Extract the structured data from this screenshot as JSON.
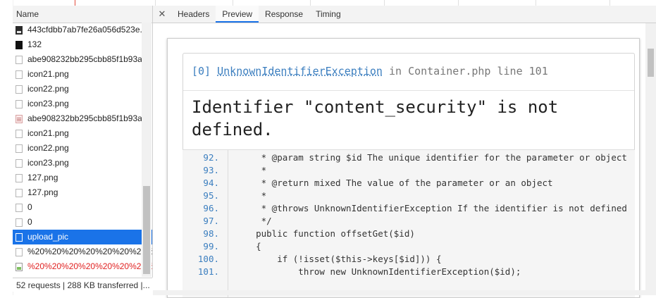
{
  "network": {
    "name_header": "Name",
    "rows": [
      {
        "label": "443cfdbb7ab7fe26a056d523e...",
        "icon": "image-thumbnail-icon",
        "state": "normal"
      },
      {
        "label": "132",
        "icon": "black-square-icon",
        "state": "normal"
      },
      {
        "label": "abe908232bb295cbb85f1b93a",
        "icon": "file-icon",
        "state": "normal"
      },
      {
        "label": "icon21.png",
        "icon": "file-icon",
        "state": "normal"
      },
      {
        "label": "icon22.png",
        "icon": "file-icon",
        "state": "normal"
      },
      {
        "label": "icon23.png",
        "icon": "file-icon",
        "state": "normal"
      },
      {
        "label": "abe908232bb295cbb85f1b93a",
        "icon": "document-icon",
        "state": "normal"
      },
      {
        "label": "icon21.png",
        "icon": "file-icon",
        "state": "normal"
      },
      {
        "label": "icon22.png",
        "icon": "file-icon",
        "state": "normal"
      },
      {
        "label": "icon23.png",
        "icon": "file-icon",
        "state": "normal"
      },
      {
        "label": "127.png",
        "icon": "file-icon",
        "state": "normal"
      },
      {
        "label": "127.png",
        "icon": "file-icon",
        "state": "normal"
      },
      {
        "label": "0",
        "icon": "file-icon",
        "state": "normal"
      },
      {
        "label": "0",
        "icon": "file-icon",
        "state": "normal"
      },
      {
        "label": "upload_pic",
        "icon": "file-icon",
        "state": "selected"
      },
      {
        "label": "%20%20%20%20%20%20%20%2",
        "icon": "file-icon",
        "state": "normal"
      },
      {
        "label": "%20%20%20%20%20%20%20%2",
        "icon": "broken-image-icon",
        "state": "error"
      }
    ],
    "status": "52 requests  |  288 KB transferred  |..."
  },
  "detail": {
    "close_glyph": "✕",
    "tabs": [
      {
        "label": "Headers",
        "active": false
      },
      {
        "label": "Preview",
        "active": true
      },
      {
        "label": "Response",
        "active": false
      },
      {
        "label": "Timing",
        "active": false
      }
    ]
  },
  "preview": {
    "exception_index": "[0]",
    "exception_class": "UnknownIdentifierException",
    "in_word": "in",
    "location": "Container.php line 101",
    "message": "Identifier \"content_security\" is not defined.",
    "code": [
      {
        "line": "92.",
        "text": "     * @param string $id The unique identifier for the parameter or object"
      },
      {
        "line": "93.",
        "text": "     *"
      },
      {
        "line": "94.",
        "text": "     * @return mixed The value of the parameter or an object"
      },
      {
        "line": "95.",
        "text": "     *"
      },
      {
        "line": "96.",
        "text": "     * @throws UnknownIdentifierException If the identifier is not defined"
      },
      {
        "line": "97.",
        "text": "     */"
      },
      {
        "line": "98.",
        "text": "    public function offsetGet($id)"
      },
      {
        "line": "99.",
        "text": "    {"
      },
      {
        "line": "100.",
        "text": "        if (!isset($this->keys[$id])) {"
      },
      {
        "line": "101.",
        "text": "            throw new UnknownIdentifierException($id);"
      }
    ]
  },
  "colors": {
    "accent": "#1a73e8",
    "error": "#e02020",
    "link": "#3b7ebf"
  }
}
